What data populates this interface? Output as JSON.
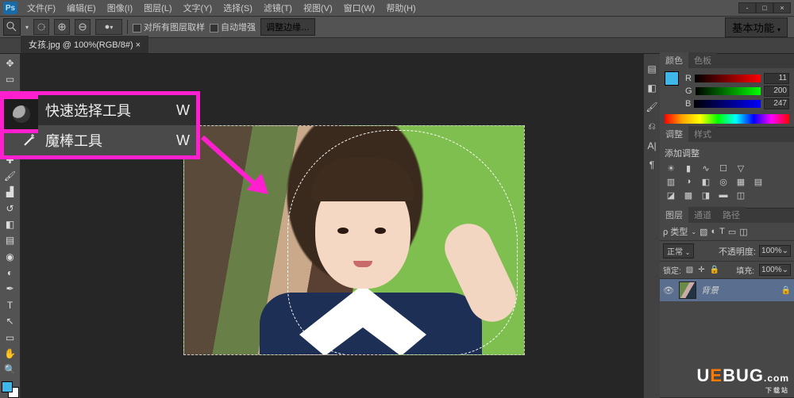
{
  "menu": {
    "file": "文件(F)",
    "edit": "编辑(E)",
    "image": "图像(I)",
    "layer": "图层(L)",
    "type": "文字(Y)",
    "select": "选择(S)",
    "filter": "滤镜(T)",
    "view": "视图(V)",
    "window": "窗口(W)",
    "help": "帮助(H)"
  },
  "options": {
    "sample_all": "对所有图层取样",
    "auto_enhance": "自动增强",
    "refine_edge": "调整边缘…",
    "workspace_btn": "基本功能"
  },
  "doc_tab": "女孩.jpg @ 100%(RGB/8#) ×",
  "flyout": {
    "quick_select": "快速选择工具",
    "magic_wand": "魔棒工具",
    "shortcut": "W"
  },
  "panels": {
    "color_tab": "颜色",
    "swatches_tab": "色板",
    "r_label": "R",
    "g_label": "G",
    "b_label": "B",
    "r_val": "11",
    "g_val": "200",
    "b_val": "247",
    "adjust_tab": "调整",
    "styles_tab": "样式",
    "add_adjustment": "添加调整",
    "layers_tab": "图层",
    "channels_tab": "通道",
    "paths_tab": "路径",
    "kind_label": "ρ 类型",
    "blend_mode": "正常",
    "opacity_label": "不透明度:",
    "opacity_val": "100%",
    "lock_label": "锁定:",
    "fill_label": "填充:",
    "fill_val": "100%",
    "layer_name": "背景"
  },
  "watermark": {
    "brand": "UEBUG",
    "suffix": ".com",
    "sub": "下载站"
  }
}
